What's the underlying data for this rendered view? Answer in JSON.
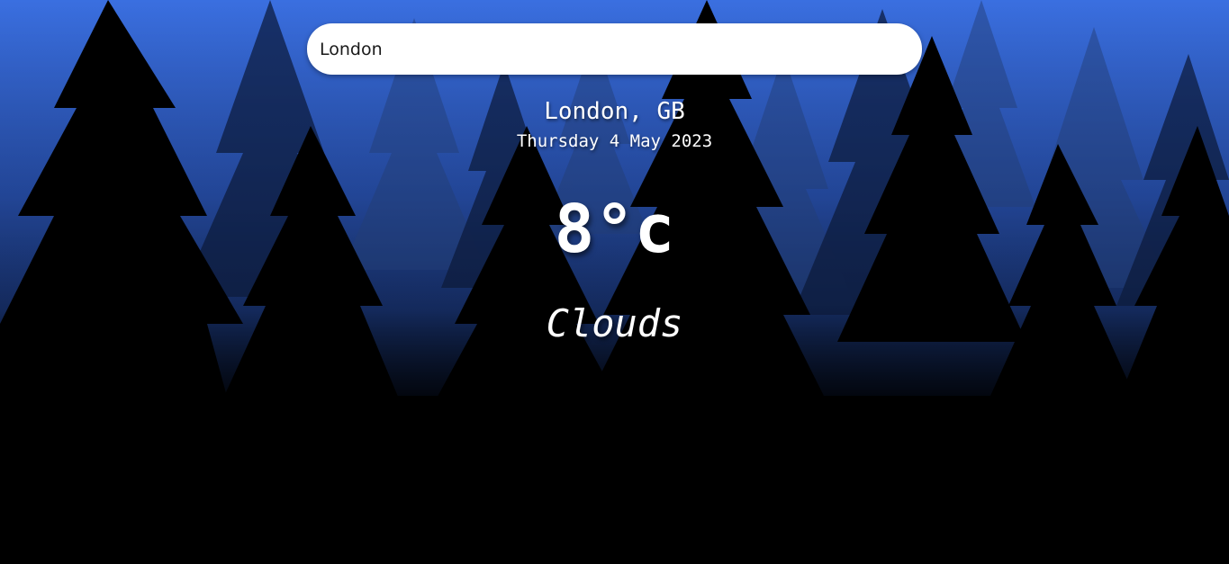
{
  "search": {
    "value": "London"
  },
  "location": {
    "name": "London, GB",
    "date": "Thursday 4 May 2023"
  },
  "weather": {
    "temperature": "8°c",
    "condition": "Clouds"
  },
  "theme": {
    "sky_top": "#3a6fe0",
    "sky_bottom": "#0c1a3a",
    "tree_back": "#1f3a73",
    "tree_mid": "#0a1530",
    "tree_front": "#000000",
    "text": "#ffffff"
  }
}
